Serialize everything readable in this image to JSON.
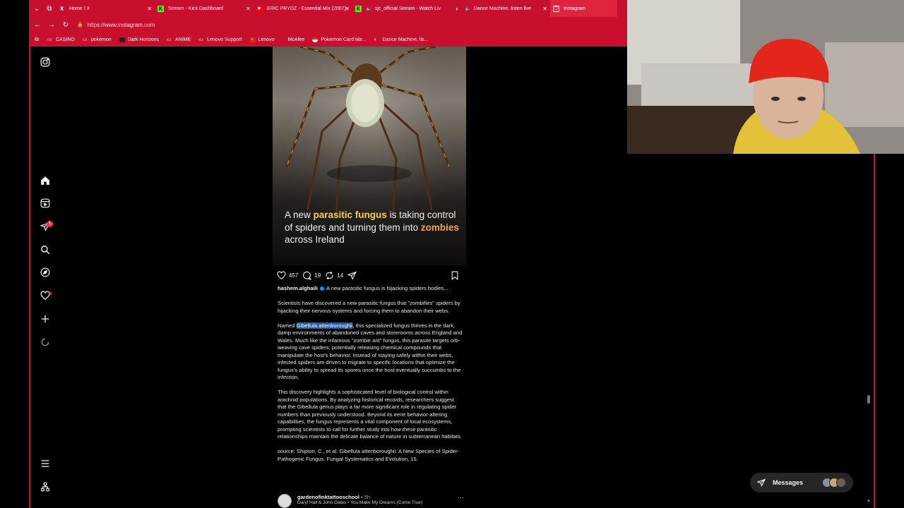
{
  "browser": {
    "tabs": [
      {
        "label": "Home / X",
        "icon": "x-logo-icon",
        "color": "#000000"
      },
      {
        "label": "Stream - Kick Dashboard",
        "icon": "kick-logo-icon",
        "color": "#53fc18"
      },
      {
        "label": "ERIC PRYDZ - Essential Mix (2007)",
        "icon": "youtube-icon",
        "color": "#ff0000"
      },
      {
        "label": "sjc_official Stream - Watch Liv",
        "icon": "kick-logo-icon",
        "color": "#53fc18"
      },
      {
        "label": "Dance Machine, listen live",
        "icon": "radio-icon",
        "color": "#ffffff"
      },
      {
        "label": "Instagram",
        "icon": "instagram-icon",
        "color": "#e1306c"
      }
    ],
    "url": "https://www.instagram.com",
    "bookmarks": [
      {
        "label": "CASINO",
        "icon": "folder-icon"
      },
      {
        "label": "pokemon",
        "icon": "folder-icon"
      },
      {
        "label": "Dark Horizons",
        "icon": "site-icon"
      },
      {
        "label": "ANIME",
        "icon": "folder-icon"
      },
      {
        "label": "Lenovo Support",
        "icon": "folder-icon"
      },
      {
        "label": "Lenovo",
        "icon": "lenovo-icon"
      },
      {
        "label": "McAfee",
        "icon": "mcafee-icon"
      },
      {
        "label": "Pokemon Card Ma...",
        "icon": "pokeball-icon"
      },
      {
        "label": "Dance Machine, lis...",
        "icon": "radio-icon"
      }
    ],
    "accent": "#c8102e"
  },
  "sidebar": {
    "notification_count": "1",
    "items": [
      "instagram-icon",
      "home-icon",
      "reels-icon",
      "messages-icon",
      "search-icon",
      "explore-icon",
      "notifications-icon",
      "create-icon",
      "activity-icon",
      "menu-icon",
      "also-from-meta-icon"
    ]
  },
  "post": {
    "headline_parts": [
      "A new ",
      "parasitic fungus",
      " is taking control of spiders and turning them into ",
      "zombies",
      " across Ireland"
    ],
    "likes": "457",
    "comments": "19",
    "reposts": "14",
    "username": "hashem.alghaili",
    "caption_first": "A new parasitic fungus is hijacking spiders bodies...",
    "para1": "Scientists have discovered a new parasitic fungus that \"zombifies\" spiders by hijacking their nervous systems and forcing them to abandon their webs.",
    "para2_prefix": "Named ",
    "para2_highlight": "Gibellula attenboroughii",
    "para2_rest": ", this specialized fungus thrives in the dark, damp environments of abandoned caves and storerooms across England and Wales. Much like the infamous \"zombie ant\" fungus, this parasite targets orb-weaving cave spiders, potentially releasing chemical compounds that manipulate the host's behavior. Instead of staying safely within their webs, infected spiders are driven to migrate to specific locations that optimize the fungus's ability to spread its spores once the host eventually succumbs to the infection.",
    "para3": "This discovery highlights a sophisticated level of biological control within arachnid populations. By analyzing historical records, researchers suggest that the Gibellula genus plays a far more significant role in regulating spider numbers than previously understood. Beyond its eerie behavior-altering capabilities, the fungus represents a vital component of local ecosystems, prompting scientists to call for further study into how these parasitic relationships maintain the delicate balance of nature in subterranean habitats.",
    "source": "source: Shipton, C., et al. Gibellula attenboroughii: A New Species of Spider-Pathogenic Fungus. Fungal Systematics and Evolution, 15."
  },
  "next_post": {
    "username": "gardenofinktattooschool",
    "time": "• 5h",
    "audio": "Daryl Hall & John Oates • You Make My Dreams (Come True)",
    "more": "···"
  },
  "messages": {
    "label": "Messages"
  }
}
